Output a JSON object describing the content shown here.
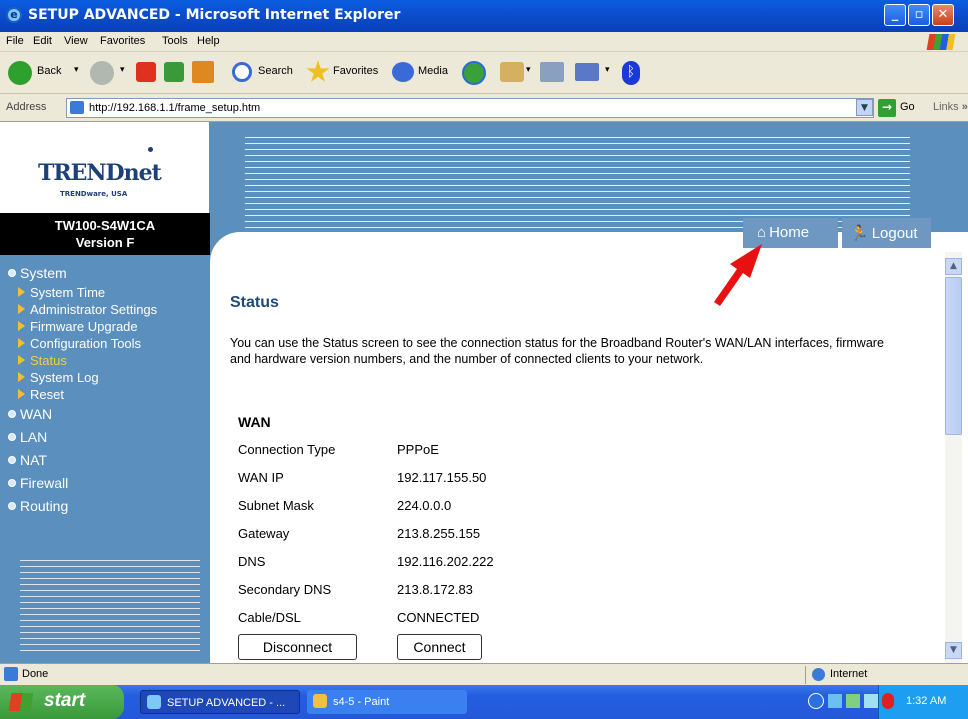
{
  "window": {
    "title": "SETUP ADVANCED - Microsoft Internet Explorer"
  },
  "menu": [
    "File",
    "Edit",
    "View",
    "Favorites",
    "Tools",
    "Help"
  ],
  "toolbar": {
    "back": "Back",
    "search": "Search",
    "favorites": "Favorites",
    "media": "Media"
  },
  "address": {
    "label": "Address",
    "url": "http://192.168.1.1/frame_setup.htm",
    "go": "Go",
    "links": "Links"
  },
  "brand": {
    "logo": "TRENDnet",
    "tagline": "TRENDware, USA",
    "model": "TW100-S4W1CA",
    "version": "Version F"
  },
  "nav": {
    "system": "System",
    "system_items": [
      "System Time",
      "Administrator Settings",
      "Firmware Upgrade",
      "Configuration Tools",
      "Status",
      "System Log",
      "Reset"
    ],
    "active": "Status",
    "sections": [
      "WAN",
      "LAN",
      "NAT",
      "Firewall",
      "Routing"
    ]
  },
  "header": {
    "home": "Home",
    "logout": "Logout"
  },
  "content": {
    "title": "Status",
    "description": "You can use the Status screen to see the connection status for the Broadband Router's WAN/LAN interfaces, firmware and hardware version numbers, and the number of connected clients to your network.",
    "wan_heading": "WAN",
    "rows": [
      {
        "label": "Connection Type",
        "value": "PPPoE"
      },
      {
        "label": "WAN IP",
        "value": "192.117.155.50"
      },
      {
        "label": "Subnet Mask",
        "value": "224.0.0.0"
      },
      {
        "label": "Gateway",
        "value": "213.8.255.155"
      },
      {
        "label": "DNS",
        "value": "192.116.202.222"
      },
      {
        "label": "Secondary DNS",
        "value": "213.8.172.83"
      },
      {
        "label": "Cable/DSL",
        "value": "CONNECTED"
      }
    ],
    "disconnect": "Disconnect",
    "connect": "Connect"
  },
  "statusbar": {
    "done": "Done",
    "zone": "Internet"
  },
  "taskbar": {
    "start": "start",
    "task1": "SETUP ADVANCED - ...",
    "task2": "s4-5 - Paint",
    "time": "1:32 AM"
  }
}
